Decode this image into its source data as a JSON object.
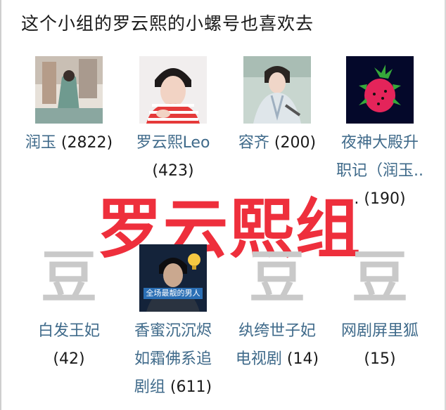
{
  "title": "这个小组的罗云熙的小螺号也喜欢去",
  "watermark": "罗云熙组",
  "groups": [
    {
      "name": "润玉",
      "count": "(2822)"
    },
    {
      "name": "罗云熙Leo",
      "count": "(423)"
    },
    {
      "name": "容齐",
      "count": "(200)"
    },
    {
      "name": "夜神大殿升职记（润玉..",
      "name_line1": "夜神大殿升",
      "name_line2": "职记（润玉..",
      "count": ". (190)"
    },
    {
      "name": "白发王妃",
      "count": "(42)",
      "placeholder": "豆"
    },
    {
      "name": "香蜜沉沉烬如霜佛系追剧组",
      "name_line1": "香蜜沉沉烬",
      "name_line2": "如霜佛系追",
      "name_line3": "剧组",
      "count": "(611)",
      "image_caption": "全场最靓的男人"
    },
    {
      "name": "纨绔世子妃电视剧",
      "name_line1": "纨绔世子妃",
      "name_line2": "电视剧",
      "count": "(14)",
      "placeholder": "豆"
    },
    {
      "name": "网剧屏里狐",
      "count": "(15)",
      "placeholder": "豆"
    }
  ]
}
